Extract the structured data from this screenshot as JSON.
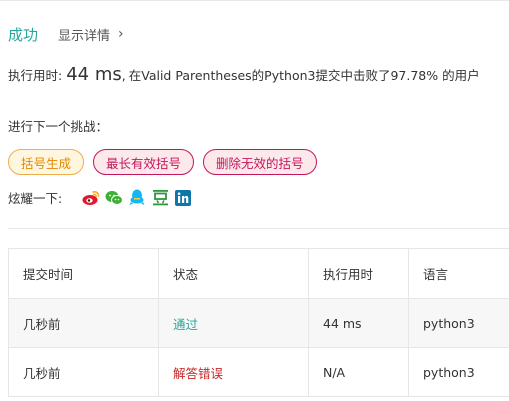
{
  "result": {
    "status": "成功",
    "details_link": "显示详情",
    "summary_prefix": "执行用时:",
    "runtime": "44 ms",
    "summary_suffix": "在Valid Parentheses的Python3提交中击败了97.78% 的用户"
  },
  "challenge": {
    "label": "进行下一个挑战：",
    "tags": [
      {
        "label": "括号生成",
        "difficulty": "medium"
      },
      {
        "label": "最长有效括号",
        "difficulty": "hard"
      },
      {
        "label": "删除无效的括号",
        "difficulty": "hard"
      }
    ]
  },
  "share": {
    "label": "炫耀一下:",
    "icons": [
      "weibo-icon",
      "wechat-icon",
      "qq-icon",
      "douban-icon",
      "linkedin-icon"
    ]
  },
  "colors": {
    "success": "#26a69a",
    "error": "#c62828",
    "medium": "#e08a00",
    "hard": "#c2185b",
    "weibo": "#e6162d",
    "wechat": "#3db035",
    "qq": "#12b7f5",
    "douban": "#2e963d",
    "linkedin": "#0e76a8"
  },
  "submissions": {
    "headers": [
      "提交时间",
      "状态",
      "执行用时",
      "语言"
    ],
    "rows": [
      {
        "time": "几秒前",
        "status": "通过",
        "runtime": "44 ms",
        "language": "python3"
      },
      {
        "time": "几秒前",
        "status": "解答错误",
        "runtime": "N/A",
        "language": "python3"
      }
    ]
  }
}
